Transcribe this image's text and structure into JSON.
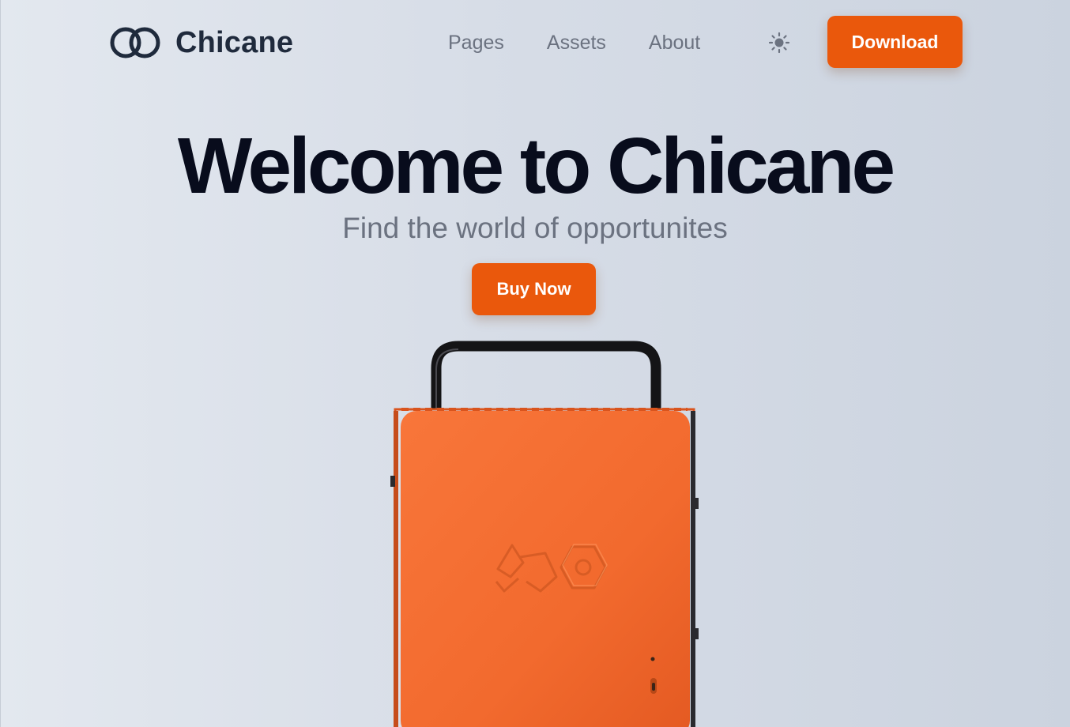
{
  "brand": {
    "name": "Chicane",
    "logo_icon": "interlocking-rings-icon"
  },
  "nav": {
    "links": [
      {
        "label": "Pages"
      },
      {
        "label": "Assets"
      },
      {
        "label": "About"
      }
    ],
    "theme_toggle_icon": "sun-icon",
    "download_label": "Download"
  },
  "hero": {
    "title": "Welcome to Chicane",
    "subtitle": "Find the world of opportunites",
    "cta_label": "Buy Now",
    "image": "orange-computer-case-with-handle"
  },
  "colors": {
    "accent": "#ea580c",
    "heading": "#080c1c",
    "brand_text": "#1f2a3c",
    "muted": "#6b7280",
    "product_orange": "#f26a2e"
  }
}
